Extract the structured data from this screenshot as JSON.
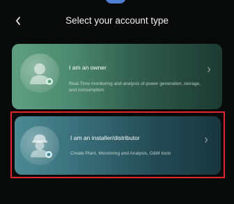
{
  "header": {
    "back_icon": "chevron-left-icon",
    "title": "Select your account type"
  },
  "cards": [
    {
      "title": "I am an owner",
      "description": "Real-Time monitoring and analysis of power generation, storage, and consumption",
      "icon": "owner-avatar-icon"
    },
    {
      "title": "I am an installer/distributor",
      "description": "Create Plant, Monitoring and Analysis, O&M tools",
      "icon": "installer-avatar-icon"
    }
  ],
  "colors": {
    "background": "#070a09",
    "selection_border": "#e3262c",
    "top_indicator": "#4d7fd3"
  }
}
